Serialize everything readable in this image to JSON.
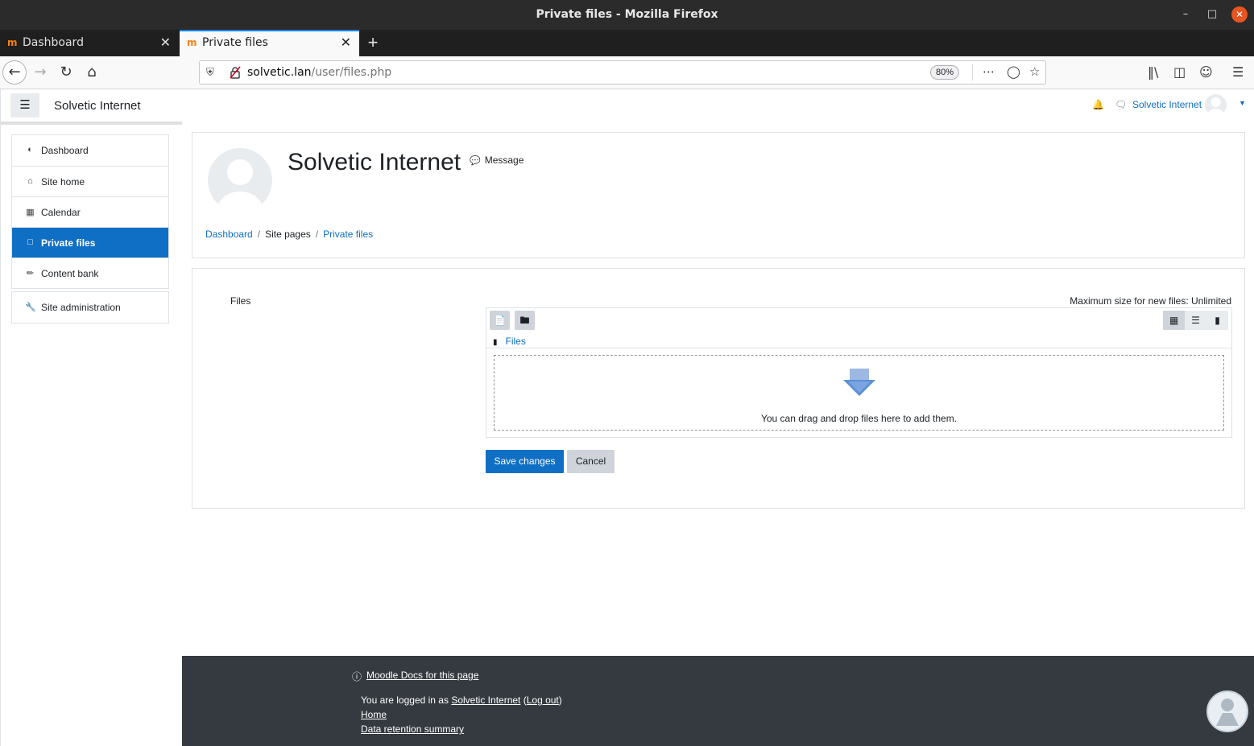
{
  "window": {
    "title": "Private files - Mozilla Firefox"
  },
  "tabs": [
    {
      "label": "Dashboard",
      "active": false
    },
    {
      "label": "Private files",
      "active": true
    }
  ],
  "urlbar": {
    "domain": "solvetic.lan",
    "path": "/user/files.php",
    "zoom": "80%"
  },
  "moodle": {
    "site_name": "Solvetic Internet",
    "user_name": "Solvetic Internet"
  },
  "drawer": {
    "items": [
      {
        "label": "Dashboard",
        "icon": "dashboard-icon",
        "active": false
      },
      {
        "label": "Site home",
        "icon": "home-icon",
        "active": false
      },
      {
        "label": "Calendar",
        "icon": "calendar-icon",
        "active": false
      },
      {
        "label": "Private files",
        "icon": "file-icon",
        "active": true
      },
      {
        "label": "Content bank",
        "icon": "brush-icon",
        "active": false
      }
    ],
    "admin": {
      "label": "Site administration",
      "icon": "wrench-icon"
    }
  },
  "profile": {
    "name": "Solvetic Internet",
    "message_label": "Message",
    "breadcrumb": [
      {
        "label": "Dashboard",
        "link": true
      },
      {
        "label": "Site pages",
        "link": false
      },
      {
        "label": "Private files",
        "link": true
      }
    ]
  },
  "filemanager": {
    "label": "Files",
    "max_size": "Maximum size for new files: Unlimited",
    "path_label": "Files",
    "drop_text": "You can drag and drop files here to add them.",
    "save_label": "Save changes",
    "cancel_label": "Cancel"
  },
  "footer": {
    "docs_link": "Moodle Docs for this page",
    "logged_in_prefix": "You are logged in as",
    "logged_in_user": "Solvetic Internet",
    "logout": "Log out",
    "home": "Home",
    "retention": "Data retention summary"
  },
  "colors": {
    "accent": "#0f6fc5",
    "footer_bg": "#343a40",
    "titlebar": "#2b2b2b"
  }
}
